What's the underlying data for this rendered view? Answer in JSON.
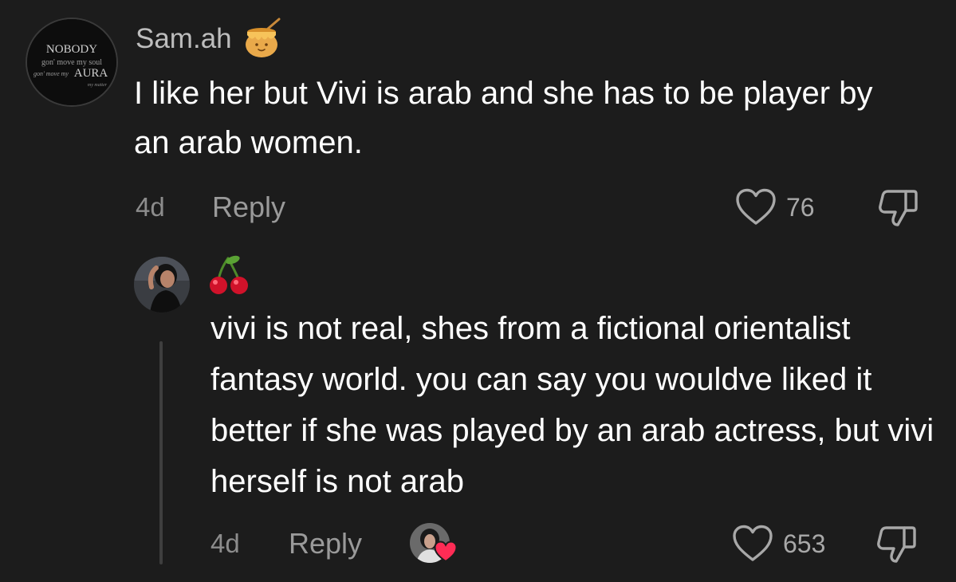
{
  "comment": {
    "username": "Sam.ah",
    "badge_icon": "honey-pot-icon",
    "avatar_icon": "nobody-aura-avatar",
    "avatar_text": {
      "line1": "NOBODY",
      "line2": "gon' move my soul",
      "line3": "gon' move my",
      "line4": "AURA",
      "line5": "my matter"
    },
    "text": "I like her but Vivi is arab and she has to be player by an arab women.",
    "time": "4d",
    "reply_label": "Reply",
    "like_count": "76",
    "like_icon": "heart-outline-icon",
    "dislike_icon": "thumbs-down-icon"
  },
  "reply": {
    "badge_icon": "cherries-icon",
    "avatar_icon": "profile-photo-avatar",
    "text": "vivi is not real, shes from a fictional orientalist fantasy world. you can say you wouldve liked it better if she was played by an arab actress, but vivi herself is not arab",
    "time": "4d",
    "reply_label": "Reply",
    "creator_liked_icon": "creator-liked-heart-icon",
    "like_count": "653",
    "like_icon": "heart-outline-icon",
    "dislike_icon": "thumbs-down-icon"
  },
  "colors": {
    "background": "#1c1c1c",
    "primary_text": "#ffffff",
    "secondary_text": "#9a9a9a",
    "heart_red": "#fe2c55"
  }
}
